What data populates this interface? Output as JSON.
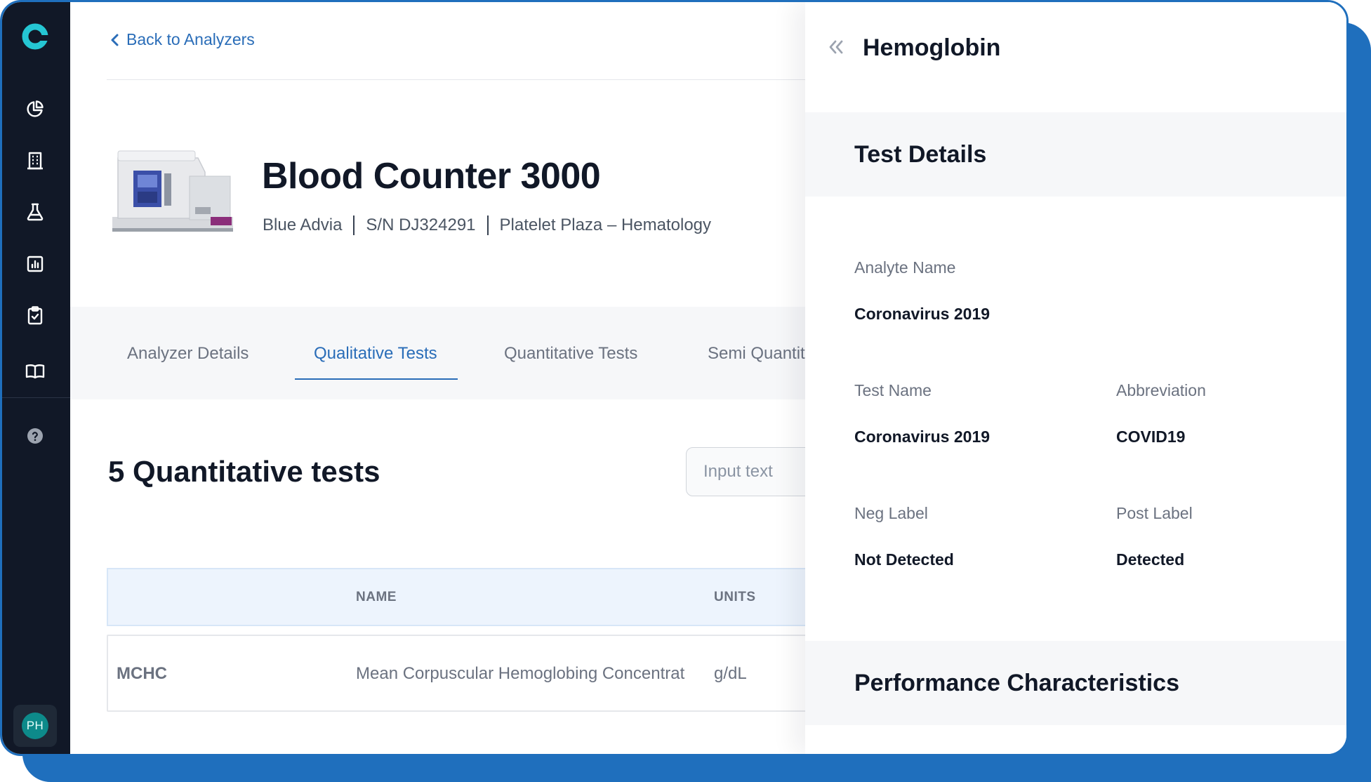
{
  "nav": {
    "back_label": "Back to Analyzers",
    "icons": [
      "logo-icon",
      "pie-chart-icon",
      "building-icon",
      "flask-icon",
      "bar-chart-icon",
      "clipboard-check-icon",
      "book-icon",
      "help-icon"
    ],
    "avatar_initials": "PH"
  },
  "analyzer": {
    "title": "Blood Counter 3000",
    "model": "Blue Advia",
    "serial": "S/N DJ324291",
    "location": "Platelet Plaza – Hematology"
  },
  "tabs": [
    {
      "label": "Analyzer Details",
      "active": false
    },
    {
      "label": "Qualitative Tests",
      "active": true
    },
    {
      "label": "Quantitative Tests",
      "active": false
    },
    {
      "label": "Semi Quantit",
      "active": false
    }
  ],
  "tests": {
    "count_title": "5 Quantitative tests",
    "search_placeholder": "Input text",
    "columns": [
      "NAME",
      "UNITS"
    ],
    "rows": [
      {
        "abbr": "MCHC",
        "name": "Mean Corpuscular Hemoglobing Concentrat",
        "units": "g/dL"
      }
    ]
  },
  "drawer": {
    "title": "Hemoglobin",
    "sections": {
      "test_details": "Test Details",
      "performance": "Performance Characteristics"
    },
    "fields": {
      "analyte_name": {
        "label": "Analyte Name",
        "value": "Coronavirus 2019"
      },
      "test_name": {
        "label": "Test  Name",
        "value": "Coronavirus 2019"
      },
      "abbreviation": {
        "label": "Abbreviation",
        "value": "COVID19"
      },
      "neg_label": {
        "label": "Neg Label",
        "value": "Not Detected"
      },
      "post_label": {
        "label": "Post Label",
        "value": "Detected"
      }
    }
  },
  "colors": {
    "accent": "#2a6db8",
    "sidebar": "#111827",
    "frame": "#1f6fbd",
    "avatar": "#0d8a8a"
  }
}
